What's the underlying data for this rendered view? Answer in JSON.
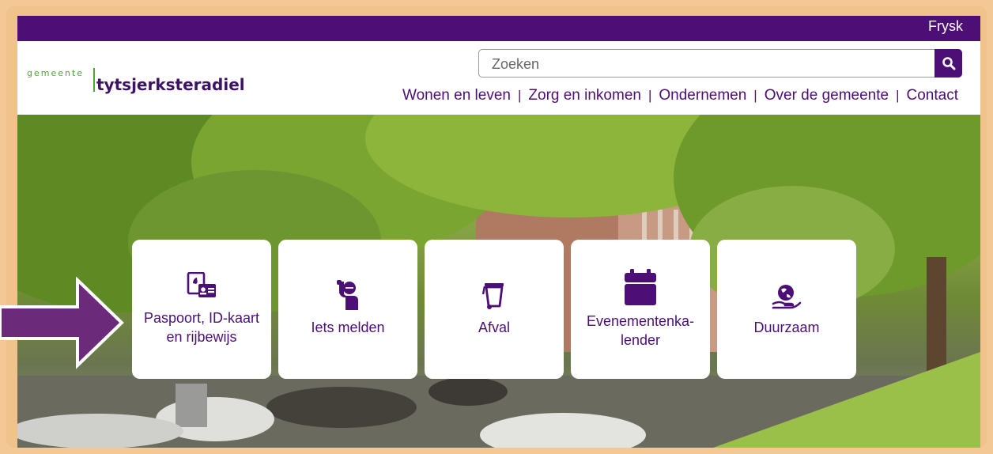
{
  "topbar": {
    "language_link": "Frysk"
  },
  "logo": {
    "prefix": "gemeente",
    "name": "tytsjerksteradiel"
  },
  "search": {
    "placeholder": "Zoeken"
  },
  "nav": {
    "items": [
      "Wonen en leven",
      "Zorg en inkomen",
      "Ondernemen",
      "Over de gemeente",
      "Contact"
    ]
  },
  "tiles": [
    {
      "label": "Paspoort, ID-kaart\nen rijbewijs",
      "icon": "passport-id-icon"
    },
    {
      "label": "Iets melden",
      "icon": "report-person-icon"
    },
    {
      "label": "Afval",
      "icon": "waste-bin-icon"
    },
    {
      "label": "Evenementenka-\nlender",
      "icon": "calendar-icon"
    },
    {
      "label": "Duurzaam",
      "icon": "globe-hand-icon"
    }
  ],
  "colors": {
    "brand_purple": "#4b0f75",
    "logo_green": "#4aa832",
    "frame_orange": "#f0c28c",
    "arrow_purple": "#6b2a7a"
  }
}
